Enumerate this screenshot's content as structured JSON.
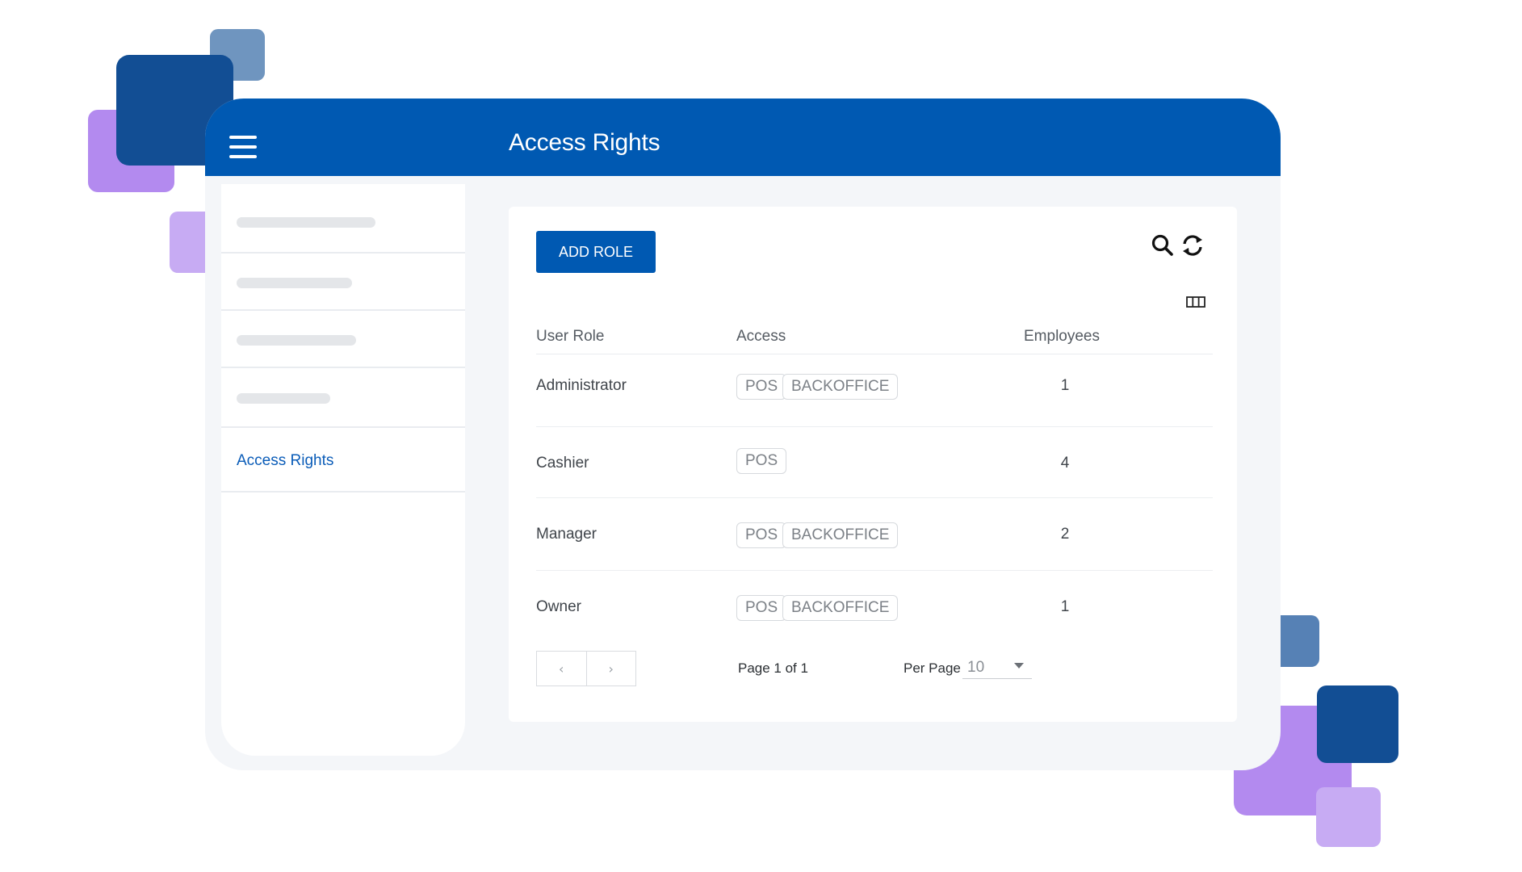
{
  "colors": {
    "header": "#0059b2",
    "accent": "#0a5cb8",
    "frame_bg": "#f4f6f9",
    "deco_dark_blue": "#124e94",
    "deco_steel_blue": "#6f95bf",
    "deco_purple": "#b38aef",
    "deco_lilac": "#c7abf3"
  },
  "header": {
    "title": "Access Rights",
    "menu_icon": "hamburger-menu-icon"
  },
  "sidebar": {
    "placeholder_items": 4,
    "active_item": {
      "label": "Access Rights"
    }
  },
  "toolbar": {
    "add_role_label": "ADD ROLE",
    "search_icon": "search-icon",
    "refresh_icon": "refresh-icon",
    "columns_icon": "columns-icon"
  },
  "table": {
    "columns": [
      "User Role",
      "Access",
      "Employees"
    ],
    "rows": [
      {
        "role": "Administrator",
        "access": [
          "POS",
          "BACKOFFICE"
        ],
        "employees": "1"
      },
      {
        "role": "Cashier",
        "access": [
          "POS"
        ],
        "employees": "4"
      },
      {
        "role": "Manager",
        "access": [
          "POS",
          "BACKOFFICE"
        ],
        "employees": "2"
      },
      {
        "role": "Owner",
        "access": [
          "POS",
          "BACKOFFICE"
        ],
        "employees": "1"
      }
    ]
  },
  "pagination": {
    "prev_label": "‹",
    "next_label": "›",
    "page_info": "Page 1 of 1",
    "per_page_label": "Per Page",
    "per_page_value": "10"
  }
}
